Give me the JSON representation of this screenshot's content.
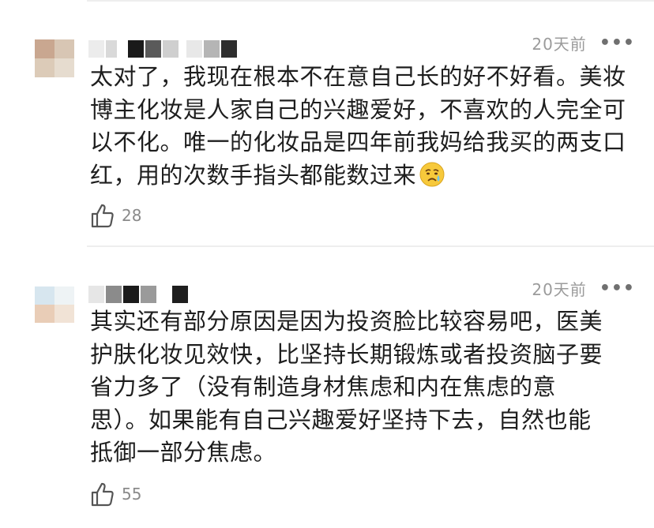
{
  "comments": [
    {
      "time": "20天前",
      "more": "•••",
      "text": "太对了，我现在根本不在意自己长的好不好看。美妆博主化妆是人家自己的兴趣爱好，不喜欢的人完全可以不化。唯一的化妆品是四年前我妈给我买的两支口红，用的次数手指头都能数过来",
      "emoji_icon": "crying-face-icon",
      "likes": "28"
    },
    {
      "time": "20天前",
      "more": "•••",
      "text_lines": [
        "其实还有部分原因是因为投资脸比较容易吧，医美",
        "护肤化妆见效快，比坚持长期锻炼或者投资脑子要",
        "省力多了（没有制造身材焦虑和内在焦虑的意",
        "思）。如果能有自己兴趣爱好坚持下去，自然也能",
        "抵御一部分焦虑。"
      ],
      "likes": "55"
    }
  ]
}
